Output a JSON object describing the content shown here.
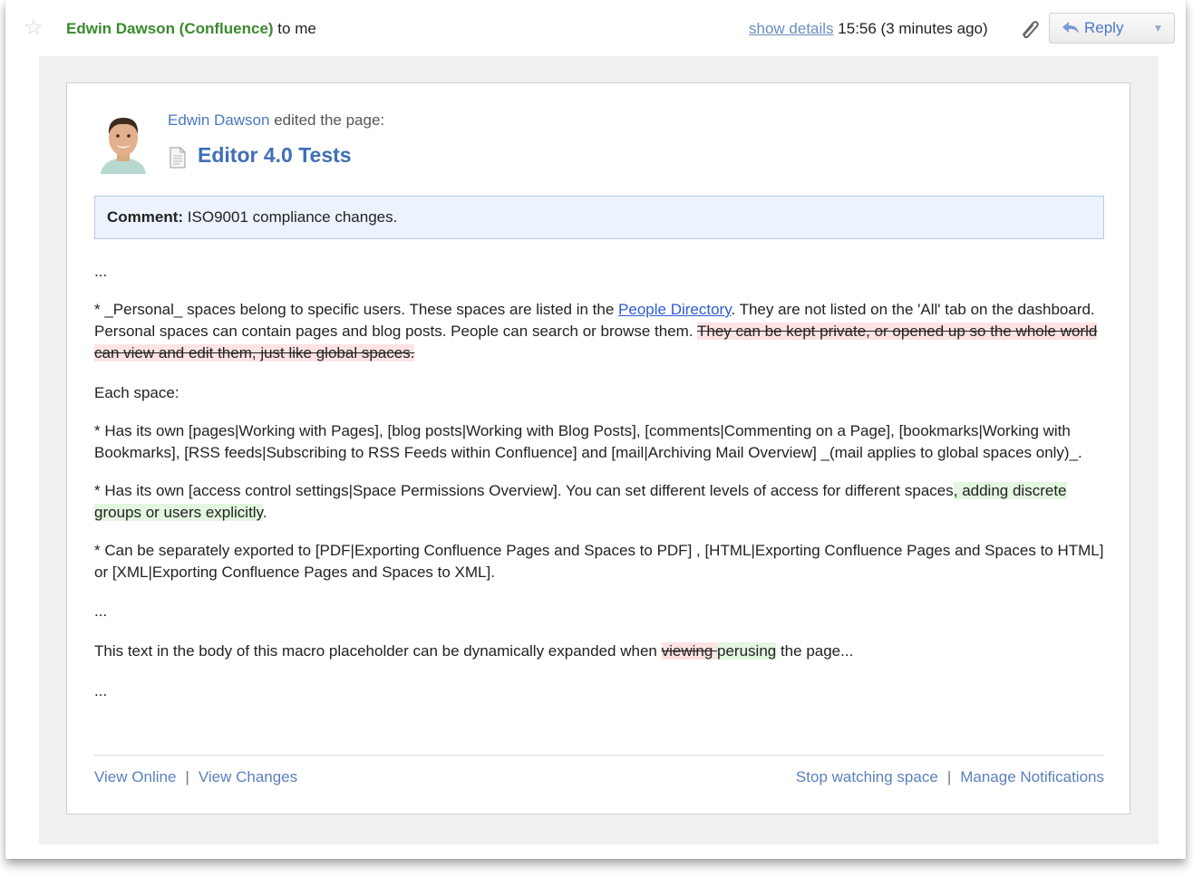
{
  "header": {
    "sender_name": "Edwin Dawson (Confluence)",
    "recipient": "to me",
    "show_details": "show details",
    "time": "15:56 (3 minutes ago)",
    "reply_label": "Reply"
  },
  "notification": {
    "editor_name": "Edwin Dawson",
    "action": "edited the page:",
    "page_title": "Editor 4.0 Tests",
    "comment_label": "Comment:",
    "comment_text": "ISO9001 compliance changes."
  },
  "body": {
    "ellipsis1": "...",
    "p1_a": "* _Personal_ spaces belong to specific users. These spaces are listed in the ",
    "p1_link": "People Directory",
    "p1_b": ". They are not listed on the 'All' tab on the dashboard. Personal spaces can contain pages and blog posts. People can search or browse them. ",
    "p1_deleted": "They can be kept private, or opened up so the whole world can view and edit them, just like global spaces.",
    "each_space": "Each space:",
    "p2": "* Has its own [pages|Working with Pages], [blog posts|Working with Blog Posts], [comments|Commenting on a Page], [bookmarks|Working with Bookmarks], [RSS feeds|Subscribing to RSS Feeds within Confluence] and [mail|Archiving Mail Overview] _(mail applies to global spaces only)_.",
    "p3_a": "* Has its own [access control settings|Space Permissions Overview]. You can set different levels of access for different spaces",
    "p3_inserted": ", adding discrete groups or users explicitly",
    "p3_b": ".",
    "p4": "* Can be separately exported to [PDF|Exporting Confluence Pages and Spaces to PDF] , [HTML|Exporting Confluence Pages and Spaces to HTML] or [XML|Exporting Confluence Pages and Spaces to XML].",
    "ellipsis2": "...",
    "p5_a": "This text in the body of this macro placeholder can be dynamically expanded when ",
    "p5_deleted": "viewing ",
    "p5_inserted": "perusing",
    "p5_b": " the page...",
    "ellipsis3": "..."
  },
  "footer": {
    "view_online": "View Online",
    "view_changes": "View Changes",
    "stop_watching": "Stop watching space",
    "manage_notifications": "Manage Notifications",
    "separator": "|"
  },
  "icons": {
    "star": "star-icon",
    "attachment": "paperclip-icon",
    "reply": "reply-arrow-icon",
    "dropdown": "chevron-down-icon",
    "page": "page-icon"
  },
  "colors": {
    "sender": "#3a8a2e",
    "link": "#4a78c2",
    "deleted_bg": "#fde3e3",
    "inserted_bg": "#e3f6e0",
    "comment_bg": "#ecf3fc"
  }
}
